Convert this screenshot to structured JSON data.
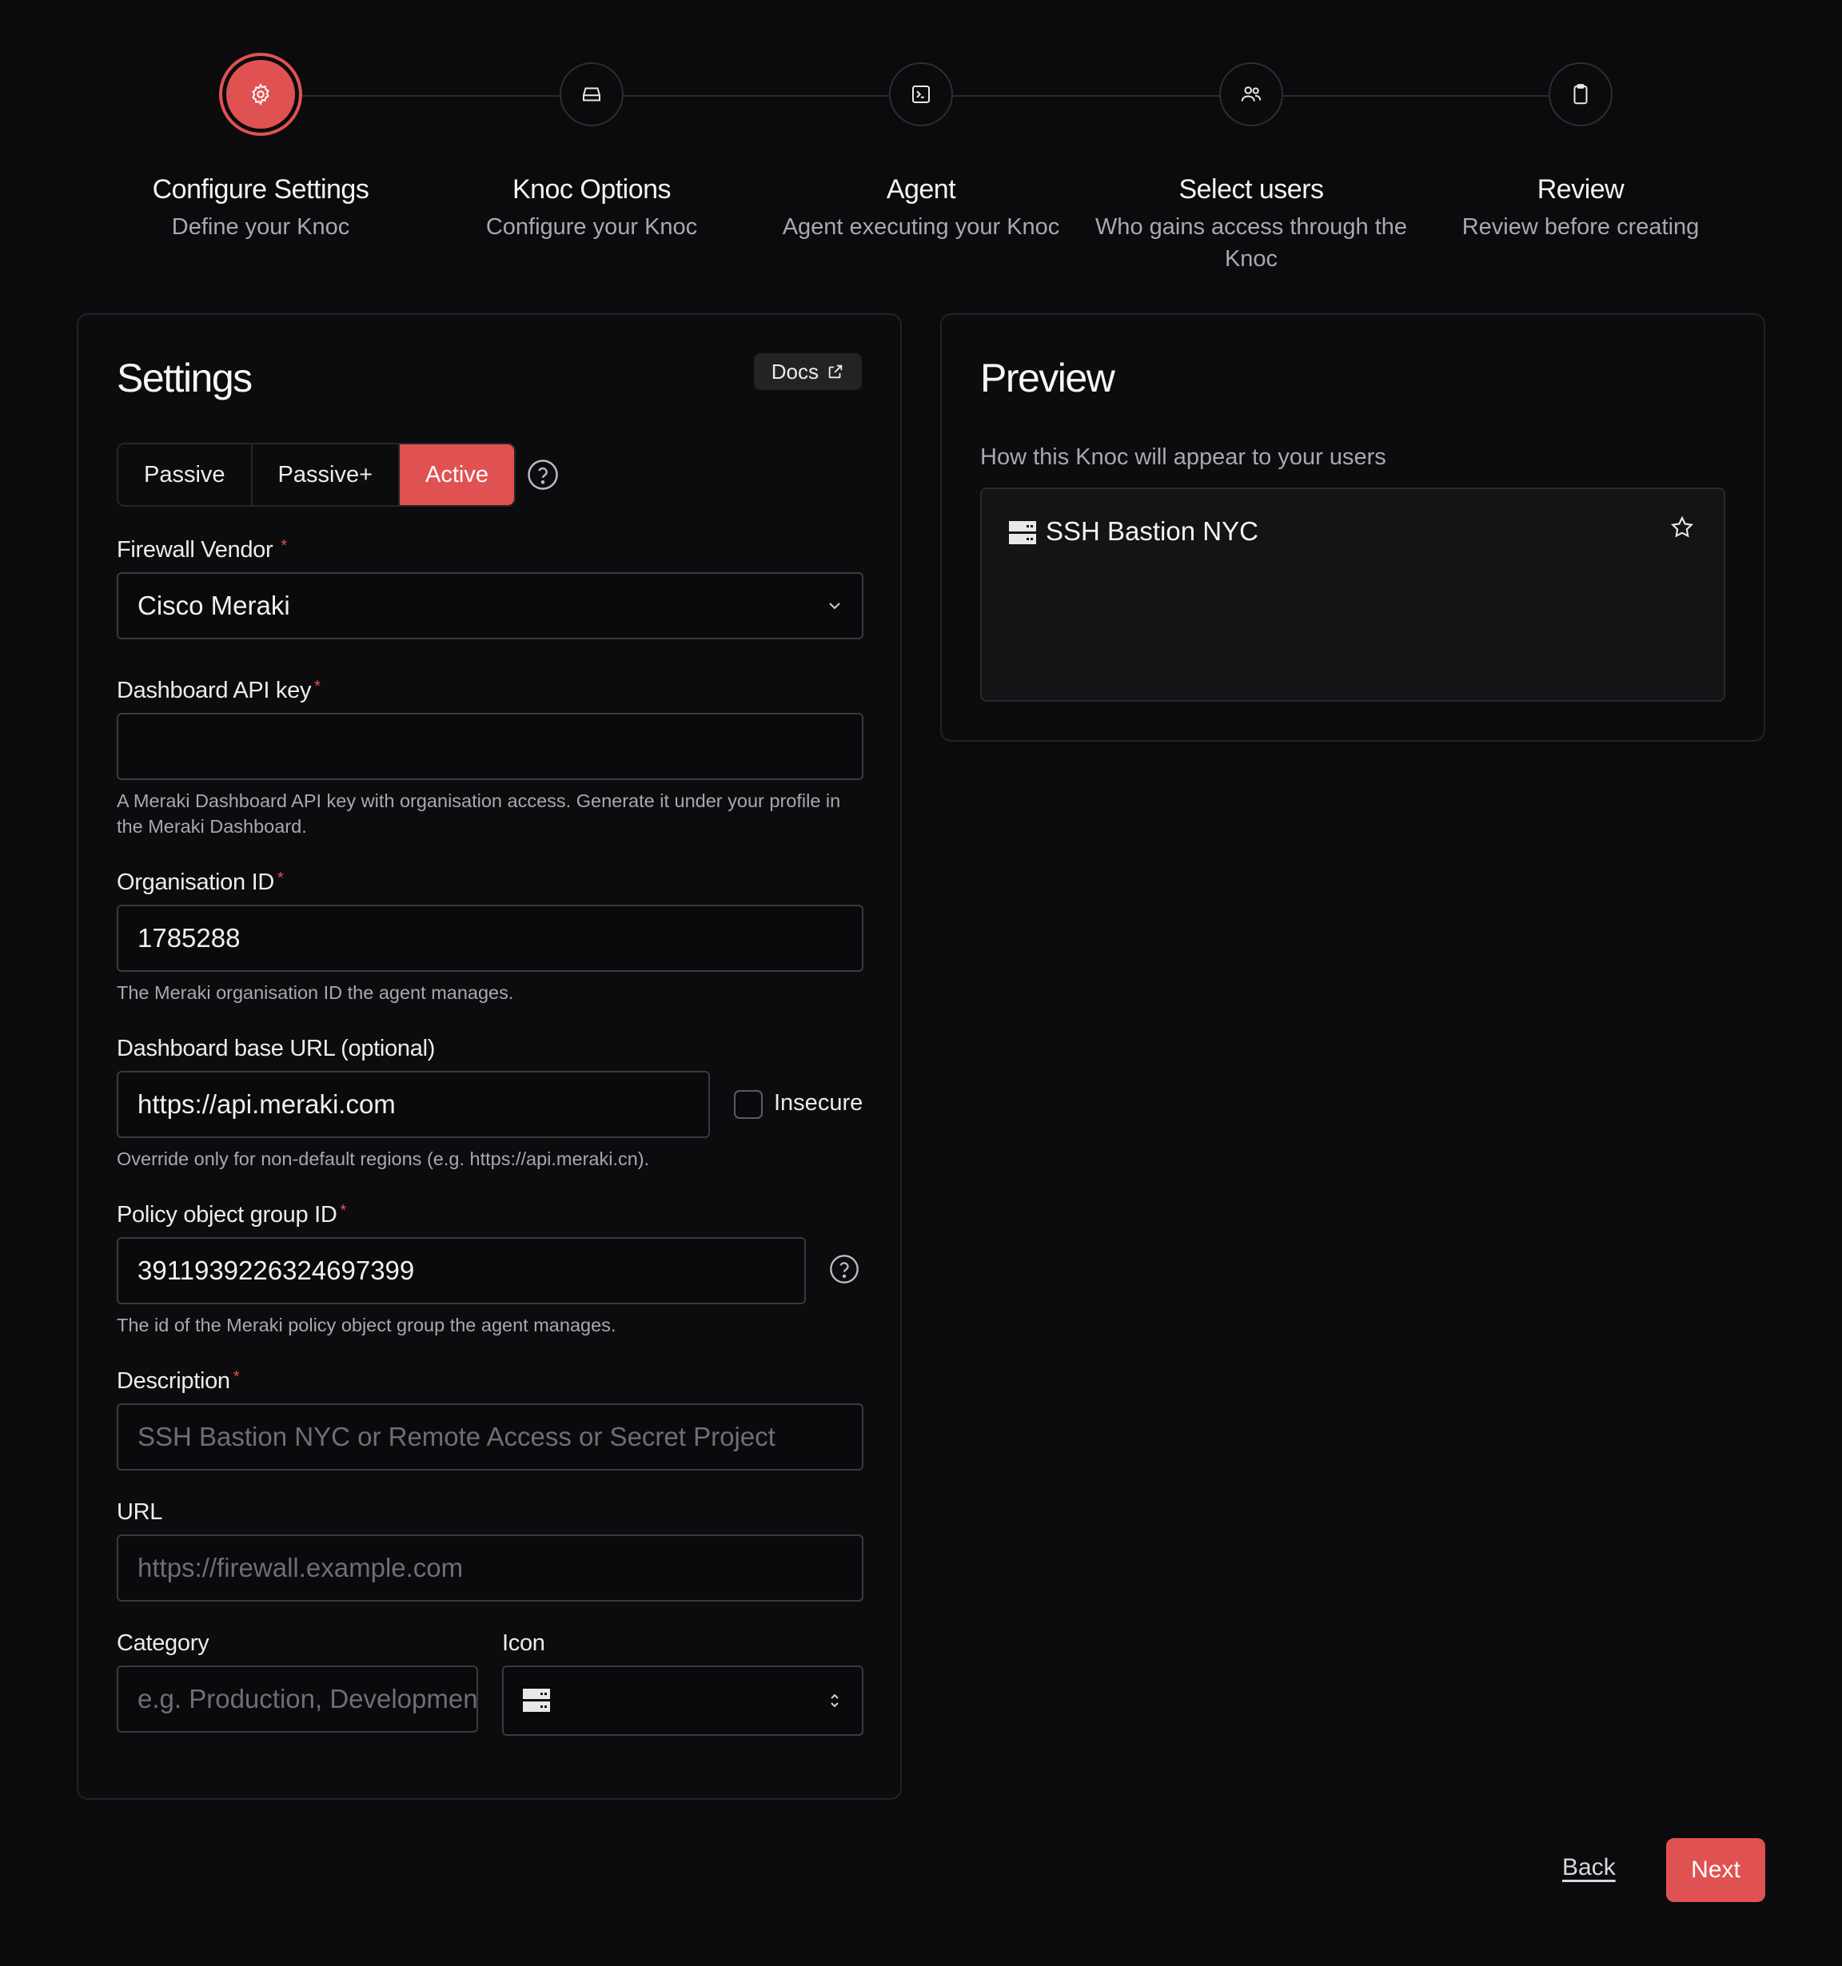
{
  "stepper": {
    "steps": [
      {
        "title": "Configure Settings",
        "subtitle": "Define your Knoc",
        "icon": "gear-icon",
        "active": true
      },
      {
        "title": "Knoc Options",
        "subtitle": "Configure your Knoc",
        "icon": "drive-icon",
        "active": false
      },
      {
        "title": "Agent",
        "subtitle": "Agent executing your Knoc",
        "icon": "terminal-icon",
        "active": false
      },
      {
        "title": "Select users",
        "subtitle": "Who gains access through the Knoc",
        "icon": "users-icon",
        "active": false
      },
      {
        "title": "Review",
        "subtitle": "Review before creating",
        "icon": "clipboard-icon",
        "active": false
      }
    ]
  },
  "settings": {
    "title": "Settings",
    "docs_label": "Docs",
    "modes": [
      "Passive",
      "Passive+",
      "Active"
    ],
    "selected_mode": "Active",
    "firewall_vendor": {
      "label": "Firewall Vendor",
      "value": "Cisco Meraki"
    },
    "api_key": {
      "label": "Dashboard API key",
      "value": "",
      "hint": "A Meraki Dashboard API key with organisation access. Generate it under your profile in the Meraki Dashboard."
    },
    "org_id": {
      "label": "Organisation ID",
      "value": "1785288",
      "hint": "The Meraki organisation ID the agent manages."
    },
    "base_url": {
      "label": "Dashboard base URL (optional)",
      "value": "https://api.meraki.com",
      "insecure_label": "Insecure",
      "insecure_checked": false,
      "hint": "Override only for non-default regions (e.g. https://api.meraki.cn)."
    },
    "policy_group": {
      "label": "Policy object group ID",
      "value": "3911939226324697399",
      "hint": "The id of the Meraki policy object group the agent manages."
    },
    "description": {
      "label": "Description",
      "placeholder": "SSH Bastion NYC or Remote Access or Secret Project"
    },
    "url": {
      "label": "URL",
      "placeholder": "https://firewall.example.com"
    },
    "category": {
      "label": "Category",
      "placeholder": "e.g. Production, Development"
    },
    "icon": {
      "label": "Icon",
      "value": "server-icon"
    }
  },
  "preview": {
    "title": "Preview",
    "subtitle": "How this Knoc will appear to your users",
    "card_name": "SSH Bastion NYC"
  },
  "footer": {
    "back_label": "Back",
    "next_label": "Next"
  },
  "colors": {
    "accent": "#e05252",
    "background": "#0b0b0d"
  }
}
